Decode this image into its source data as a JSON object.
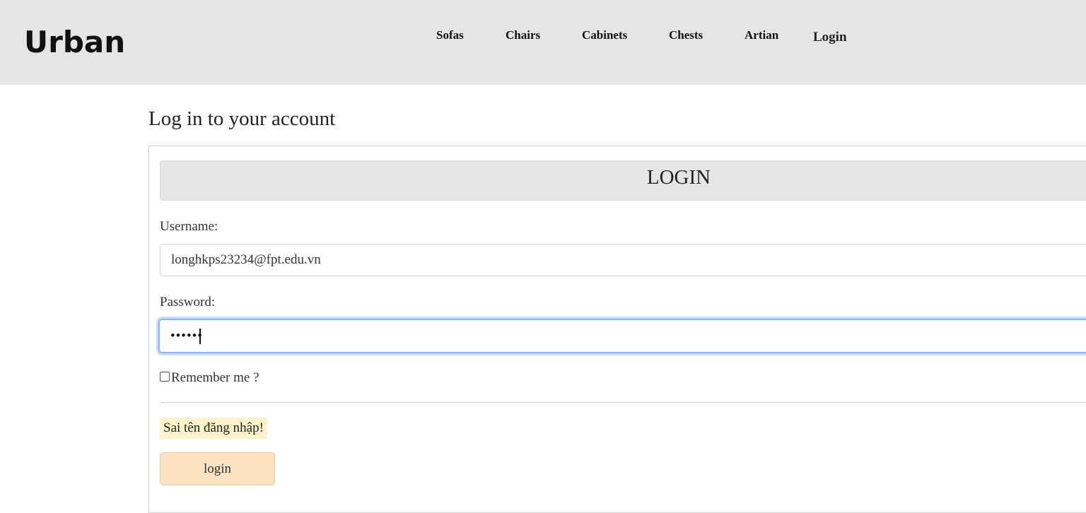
{
  "header": {
    "brand": "Urban",
    "nav": [
      "Sofas",
      "Chairs",
      "Cabinets",
      "Chests",
      "Artian"
    ],
    "login_link": "Login",
    "background_color": "#e5e5e5"
  },
  "main": {
    "page_title": "Log in to your account",
    "card_title": "LOGIN",
    "username_label": "Username:",
    "username_value": "longhkps23234@fpt.edu.vn",
    "password_label": "Password:",
    "password_masked": "••••••",
    "remember_label": "Remember me ?",
    "remember_checked": false,
    "error_message": "Sai tên đăng nhập!",
    "submit_label": "login",
    "colors": {
      "error_bg": "#fdf2c9",
      "button_bg": "#fde2c2",
      "focus_ring": "#86b7fe"
    }
  }
}
